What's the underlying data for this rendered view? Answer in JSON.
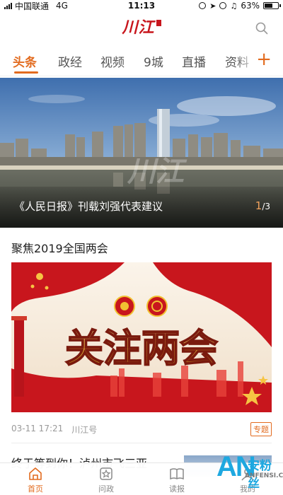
{
  "status_bar": {
    "carrier": "中国联通",
    "network": "4G",
    "time": "11:13",
    "battery_percent": "63%",
    "battery_level": 0.63
  },
  "header": {
    "logo_text": "川江",
    "search_icon": "search-icon"
  },
  "tabs": {
    "items": [
      "头条",
      "政经",
      "视频",
      "9城",
      "直播",
      "资料"
    ],
    "active_index": 0,
    "add_label": "+",
    "accent_color": "#e26b1f"
  },
  "banner": {
    "title": "《人民日报》刊载刘强代表建议",
    "pager_current": "1",
    "pager_total": "/3",
    "watermark": "川江"
  },
  "topic": {
    "section_title": "聚焦2019全国两会",
    "image_slogan": "关注两会",
    "date": "03-11 17:21",
    "source": "川江号",
    "tag": "专题"
  },
  "next_item": {
    "title": "终于等到你！泸州市飞三亚"
  },
  "bottom_nav": {
    "items": [
      {
        "label": "首页",
        "icon": "home-icon"
      },
      {
        "label": "问政",
        "icon": "star-badge-icon"
      },
      {
        "label": "读报",
        "icon": "book-icon"
      },
      {
        "label": "我的",
        "icon": "user-icon"
      }
    ],
    "active_index": 0
  },
  "site_watermark": {
    "letters": "AN",
    "name": "安粉丝",
    "domain": "ANFENSI.COM"
  }
}
